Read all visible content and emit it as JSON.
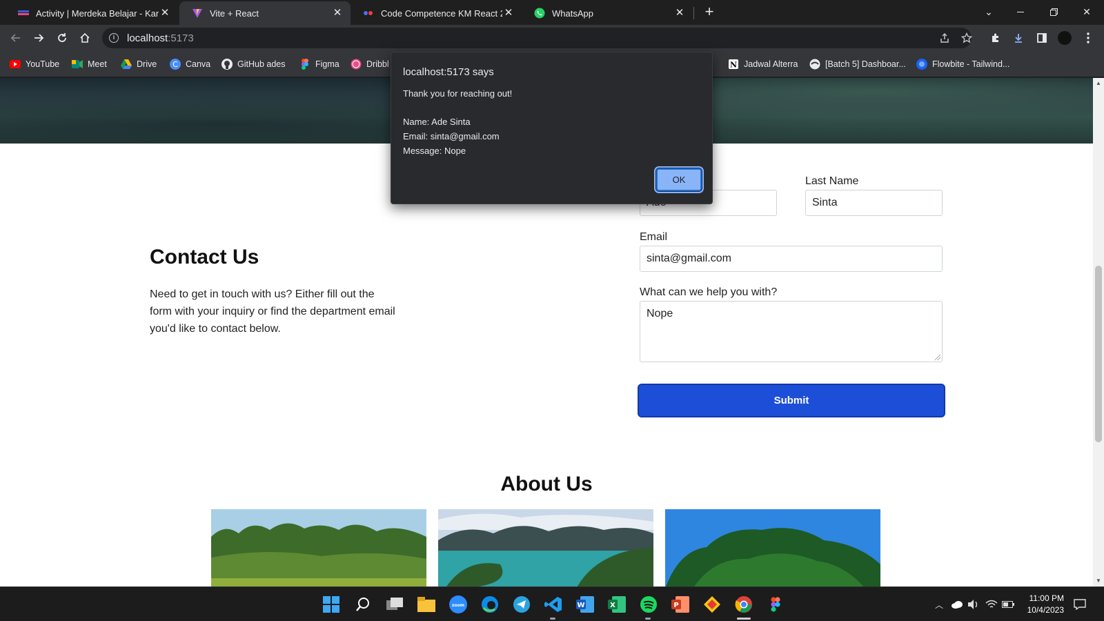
{
  "browser": {
    "tabs": [
      {
        "title": "Activity | Merdeka Belajar - Kam",
        "active": false
      },
      {
        "title": "Vite + React",
        "active": true
      },
      {
        "title": "Code Competence KM React 2 -",
        "active": false
      },
      {
        "title": "WhatsApp",
        "active": false
      }
    ],
    "new_tab_label": "+",
    "url_host": "localhost",
    "url_port": ":5173",
    "bookmarks": [
      {
        "label": "YouTube",
        "icon": "youtube-icon"
      },
      {
        "label": "Meet",
        "icon": "meet-icon"
      },
      {
        "label": "Drive",
        "icon": "drive-icon"
      },
      {
        "label": "Canva",
        "icon": "canva-icon"
      },
      {
        "label": "GitHub ades",
        "icon": "github-icon"
      },
      {
        "label": "Figma",
        "icon": "figma-icon"
      },
      {
        "label": "Dribbl",
        "icon": "dribbble-icon"
      },
      {
        "label": "Jadwal Alterra",
        "icon": "notion-icon"
      },
      {
        "label": "[Batch 5] Dashboar...",
        "icon": "globe-icon"
      },
      {
        "label": "Flowbite - Tailwind...",
        "icon": "flowbite-icon"
      }
    ]
  },
  "dialog": {
    "title": "localhost:5173 says",
    "thanks": "Thank you for reaching out!",
    "name_line": "Name: Ade Sinta",
    "email_line": "Email: sinta@gmail.com",
    "message_line": "Message: Nope",
    "ok_label": "OK"
  },
  "page": {
    "contact_title": "Contact Us",
    "contact_desc": "Need to get in touch with us? Either fill out the form with your inquiry or find the department email you'd like to contact below.",
    "form": {
      "first_name_value": "Ade",
      "last_name_label": "Last Name",
      "last_name_value": "Sinta",
      "email_label": "Email",
      "email_value": "sinta@gmail.com",
      "help_label": "What can we help you with?",
      "help_value": "Nope",
      "submit_label": "Submit"
    },
    "about_title": "About Us"
  },
  "taskbar": {
    "time": "11:00 PM",
    "date": "10/4/2023"
  },
  "colors": {
    "submit": "#1d4ed8",
    "dialog_bg": "#292a2d",
    "ok_button": "#8ab4f8"
  }
}
